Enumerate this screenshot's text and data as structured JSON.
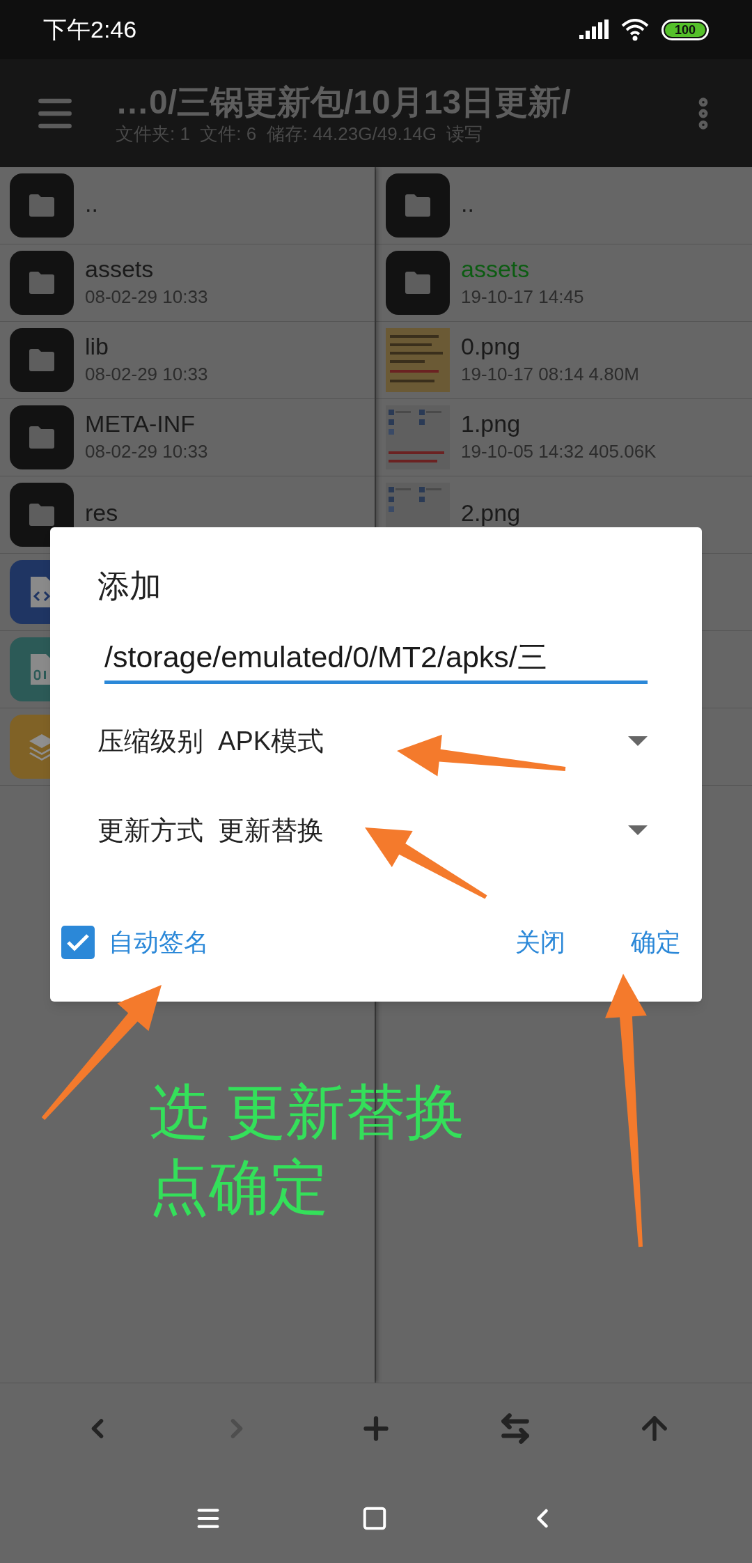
{
  "status_bar": {
    "time": "下午2:46",
    "battery": "100"
  },
  "app_bar": {
    "path": "…0/三锅更新包/10月13日更新/",
    "info": "文件夹: 1  文件: 6  储存: 44.23G/49.14G  读写"
  },
  "left_pane": {
    "rows": [
      {
        "kind": "folder",
        "name": "..",
        "color": "#1a1a1a"
      },
      {
        "kind": "folder",
        "name": "assets",
        "date": "08-02-29 10:33",
        "color": "#1a1a1a"
      },
      {
        "kind": "folder",
        "name": "lib",
        "date": "08-02-29 10:33",
        "color": "#1a1a1a"
      },
      {
        "kind": "folder",
        "name": "META-INF",
        "date": "08-02-29 10:33",
        "color": "#1a1a1a"
      },
      {
        "kind": "folder",
        "name": "res",
        "color": "#1a1a1a"
      },
      {
        "kind": "code"
      },
      {
        "kind": "binary"
      },
      {
        "kind": "layers"
      }
    ]
  },
  "right_pane": {
    "rows": [
      {
        "kind": "folder",
        "name": "..",
        "color": "#1a1a1a"
      },
      {
        "kind": "folder",
        "name": "assets",
        "date": "19-10-17 14:45",
        "color": "#0c5c12"
      },
      {
        "name": "0.png",
        "date": "19-10-17 08:14  4.80M",
        "color": "#1a1a1a"
      },
      {
        "name": "1.png",
        "date": "19-10-05 14:32  405.06K",
        "color": "#1a1a1a"
      },
      {
        "name": "2.png",
        "color": "#1a1a1a"
      }
    ]
  },
  "dialog": {
    "title": "添加",
    "field_value": "/storage/emulated/0/MT2/apks/三",
    "dropdowns": [
      {
        "label": "压缩级别",
        "value": "APK模式"
      },
      {
        "label": "更新方式",
        "value": "更新替换"
      }
    ],
    "checkbox": {
      "label": "自动签名",
      "checked": true
    },
    "buttons": [
      "关闭",
      "确定"
    ]
  },
  "annotation": {
    "lines": [
      "选 更新替换",
      "点确定"
    ]
  },
  "toolbar": [
    {
      "kind": "back",
      "disabled": false
    },
    {
      "kind": "forward",
      "disabled": true
    },
    {
      "kind": "add",
      "disabled": false
    },
    {
      "kind": "swap",
      "disabled": false
    },
    {
      "kind": "up",
      "disabled": false
    }
  ]
}
